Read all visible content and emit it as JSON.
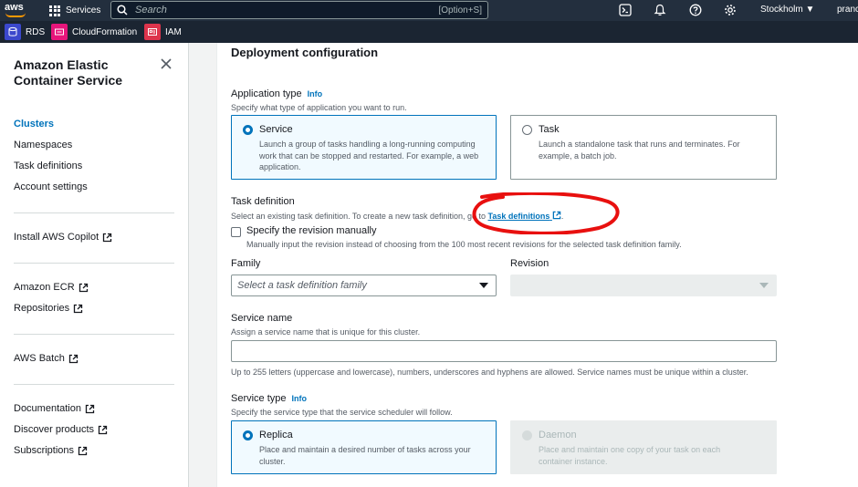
{
  "topnav": {
    "logo": "aws",
    "services_label": "Services",
    "search_placeholder": "Search",
    "search_shortcut": "[Option+S]",
    "region": "Stockholm",
    "user": "pranc",
    "icons": [
      "grid-icon",
      "search-icon",
      "cloudshell-icon",
      "notifications-icon",
      "help-icon",
      "settings-icon",
      "caret-down-icon"
    ]
  },
  "favorites": [
    {
      "label": "RDS",
      "color": "#3b48cc"
    },
    {
      "label": "CloudFormation",
      "color": "#e7157b"
    },
    {
      "label": "IAM",
      "color": "#dd344c"
    }
  ],
  "sidebar": {
    "title": "Amazon Elastic Container Service",
    "group1": [
      "Clusters",
      "Namespaces",
      "Task definitions",
      "Account settings"
    ],
    "group2": [
      "Install AWS Copilot"
    ],
    "group3": [
      "Amazon ECR",
      "Repositories"
    ],
    "group4": [
      "AWS Batch"
    ],
    "group5": [
      "Documentation",
      "Discover products",
      "Subscriptions"
    ]
  },
  "main": {
    "section_title": "Deployment configuration",
    "app_type": {
      "label": "Application type",
      "info": "Info",
      "description": "Specify what type of application you want to run.",
      "options": [
        {
          "title": "Service",
          "desc": "Launch a group of tasks handling a long-running computing work that can be stopped and restarted. For example, a web application.",
          "selected": true
        },
        {
          "title": "Task",
          "desc": "Launch a standalone task that runs and terminates. For example, a batch job.",
          "selected": false
        }
      ]
    },
    "task_def": {
      "label": "Task definition",
      "description": "Select an existing task definition. To create a new task definition, go to",
      "link": "Task definitions",
      "suffix": ".",
      "checkbox_label": "Specify the revision manually",
      "checkbox_desc": "Manually input the revision instead of choosing from the 100 most recent revisions for the selected task definition family.",
      "family_label": "Family",
      "family_placeholder": "Select a task definition family",
      "revision_label": "Revision"
    },
    "service_name": {
      "label": "Service name",
      "description": "Assign a service name that is unique for this cluster.",
      "value": "",
      "hint": "Up to 255 letters (uppercase and lowercase), numbers, underscores and hyphens are allowed. Service names must be unique within a cluster."
    },
    "service_type": {
      "label": "Service type",
      "info": "Info",
      "description": "Specify the service type that the service scheduler will follow.",
      "options": [
        {
          "title": "Replica",
          "desc": "Place and maintain a desired number of tasks across your cluster.",
          "selected": true
        },
        {
          "title": "Daemon",
          "desc": "Place and maintain one copy of your task on each container instance.",
          "disabled": true
        }
      ]
    }
  },
  "colors": {
    "annotation": "#e8100f",
    "link": "#0073bb",
    "nav_bg": "#232f3e"
  }
}
